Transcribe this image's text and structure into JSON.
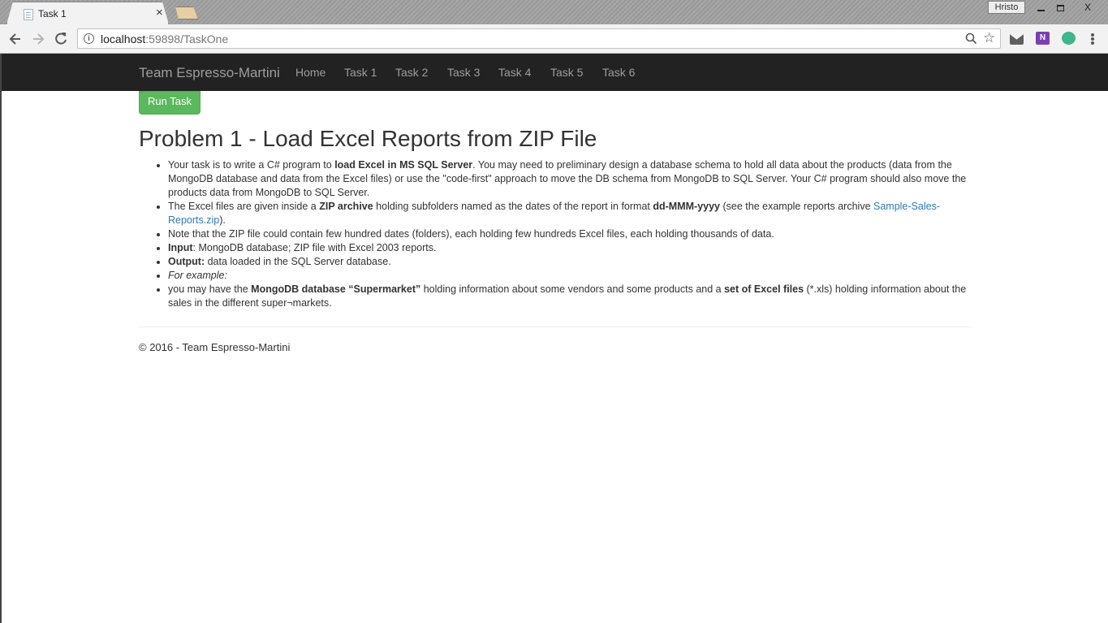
{
  "browser": {
    "tab_title": "Task 1",
    "tab_close": "×",
    "profile_name": "Hristo",
    "window_close": "X",
    "url_host": "localhost",
    "url_rest": ":59898/TaskOne",
    "icons": [
      "page-icon",
      "back-arrow-icon",
      "forward-arrow-icon",
      "reload-icon",
      "info-icon",
      "zoom-icon",
      "star-icon",
      "mail-icon",
      "onenote-icon",
      "extension-icon",
      "menu-icon"
    ]
  },
  "navbar": {
    "brand": "Team Espresso-Martini",
    "links": [
      "Home",
      "Task 1",
      "Task 2",
      "Task 3",
      "Task 4",
      "Task 5",
      "Task 6"
    ]
  },
  "main": {
    "run_button": "Run Task",
    "title": "Problem 1 - Load Excel Reports from ZIP File",
    "items": {
      "i1": {
        "t1": "Your task is to write a C# program to ",
        "b1": "load Excel in MS SQL Server",
        "t2": ". You may need to preliminary design a database schema to hold all data about the products (data from the MongoDB database and data from the Excel files) or use the \"code-first\" approach to move the DB schema from MongoDB to SQL Server. Your C# program should also move the products data from MongoDB to SQL Server."
      },
      "i2": {
        "t1": "The Excel files are given inside a ",
        "b1": "ZIP archive",
        "t2": " holding subfolders named as the dates of the report in format ",
        "b2": "dd-MMM-yyyy",
        "t3": " (see the example reports archive ",
        "link": "Sample-Sales-Reports.zip",
        "t4": ")."
      },
      "i3": "Note that the ZIP file could contain few hundred dates (folders), each holding few hundreds Excel files, each holding thousands of data.",
      "i4": {
        "b1": "Input",
        "t1": ": MongoDB database; ZIP file with Excel 2003 reports."
      },
      "i5": {
        "b1": "Output:",
        "t1": " data loaded in the SQL Server database."
      },
      "i6": "For example:",
      "i7": {
        "t1": "you may have the ",
        "b1": "MongoDB database “Supermarket”",
        "t2": " holding information about some vendors and some products and a ",
        "b2": "set of Excel files",
        "t3": " (*.xls) holding information about the sales in the different super¬markets."
      }
    }
  },
  "footer": {
    "text": "© 2016 - Team Espresso-Martini"
  }
}
